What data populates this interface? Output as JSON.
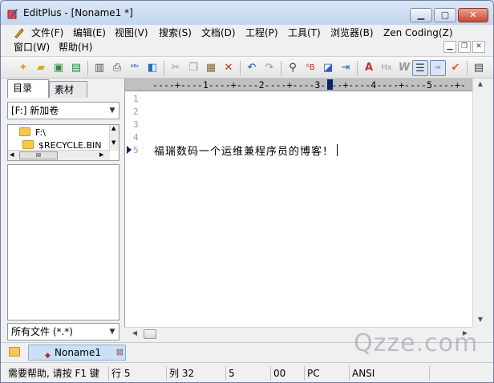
{
  "window": {
    "title": "EditPlus - [Noname1 *]"
  },
  "menus": [
    {
      "label": "文件(F)"
    },
    {
      "label": "编辑(E)"
    },
    {
      "label": "视图(V)"
    },
    {
      "label": "搜索(S)"
    },
    {
      "label": "文档(D)"
    },
    {
      "label": "工程(P)"
    },
    {
      "label": "工具(T)"
    },
    {
      "label": "浏览器(B)"
    },
    {
      "label": "Zen Coding(Z)"
    },
    {
      "label": "窗口(W)"
    },
    {
      "label": "帮助(H)"
    }
  ],
  "toolbar_icons": [
    "new-file-icon",
    "open-icon",
    "save-icon",
    "save-all-icon",
    "print-preview-icon",
    "print-icon",
    "spellcheck-icon",
    "browser-icon",
    "cut-icon",
    "copy-icon",
    "paste-icon",
    "delete-icon",
    "undo-icon",
    "redo-icon",
    "find-icon",
    "replace-icon",
    "find-in-files-icon",
    "goto-icon",
    "font-icon",
    "hex-icon",
    "word-wrap-icon",
    "line-number-icon",
    "ruler-icon",
    "check-icon",
    "options-icon"
  ],
  "panel": {
    "tabs": [
      {
        "label": "目录"
      },
      {
        "label": "素材"
      }
    ],
    "drive": "[F:] 新加卷",
    "tree": [
      "F:\\",
      "$RECYCLE.BIN"
    ],
    "filter": "所有文件 (*.*)",
    "hscroll_grip": "III"
  },
  "editor": {
    "ruler": "----+----1----+----2----+----3----+----4----+----5----+-",
    "line_numbers": [
      "1",
      "2",
      "3",
      "4",
      "5"
    ],
    "lines": [
      "",
      "",
      "",
      "",
      "福瑞数码一个运维兼程序员的博客！"
    ]
  },
  "doc_tab": {
    "label": "Noname1"
  },
  "watermark": "Qzze.com",
  "status": {
    "help": "需要帮助, 请按 F1 键",
    "line": "行 5",
    "col": "列 32",
    "sel": "5",
    "code": "00",
    "mode": "PC",
    "encoding": "ANSI"
  }
}
